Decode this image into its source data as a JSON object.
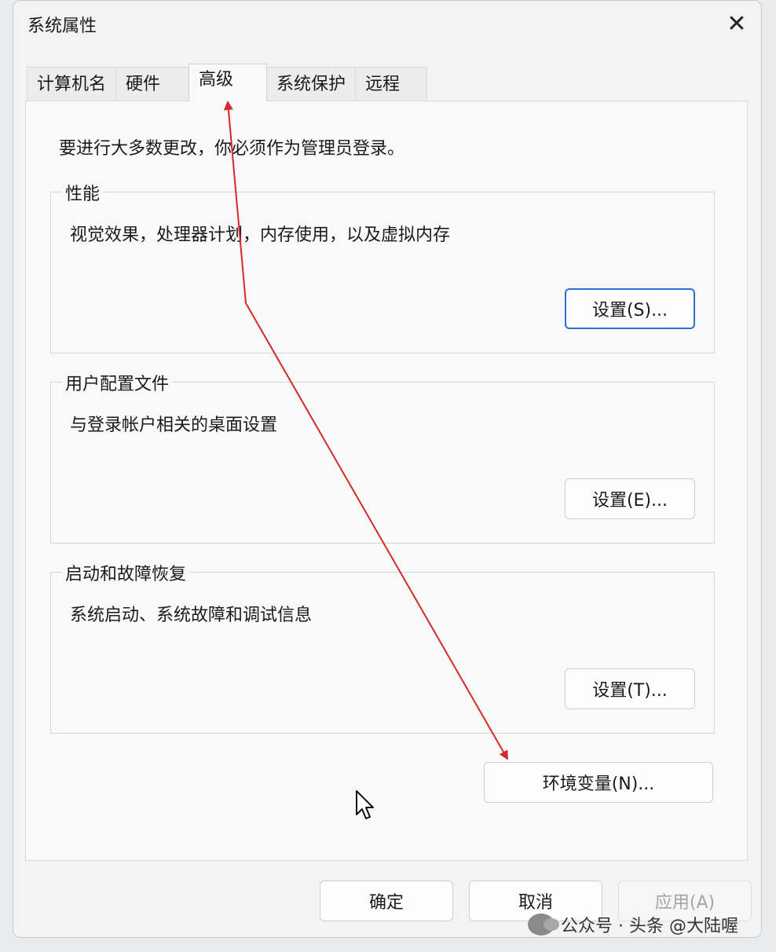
{
  "window": {
    "title": "系统属性"
  },
  "tabs": [
    {
      "label": "计算机名"
    },
    {
      "label": "硬件"
    },
    {
      "label": "高级"
    },
    {
      "label": "系统保护"
    },
    {
      "label": "远程"
    }
  ],
  "active_tab": "高级",
  "intro_text": "要进行大多数更改，你必须作为管理员登录。",
  "groups": {
    "performance": {
      "label": "性能",
      "description": "视觉效果，处理器计划，内存使用，以及虚拟内存",
      "button": "设置(S)..."
    },
    "user_profiles": {
      "label": "用户配置文件",
      "description": "与登录帐户相关的桌面设置",
      "button": "设置(E)..."
    },
    "startup_recovery": {
      "label": "启动和故障恢复",
      "description": "系统启动、系统故障和调试信息",
      "button": "设置(T)..."
    }
  },
  "env_button": "环境变量(N)...",
  "footer": {
    "ok": "确定",
    "cancel": "取消",
    "apply": "应用(A)"
  },
  "watermark": {
    "text": "公众号 · 头条 @大陆喔"
  },
  "colors": {
    "annotation_arrow": "#d42a2a",
    "focus_border": "#2f6ecf"
  }
}
